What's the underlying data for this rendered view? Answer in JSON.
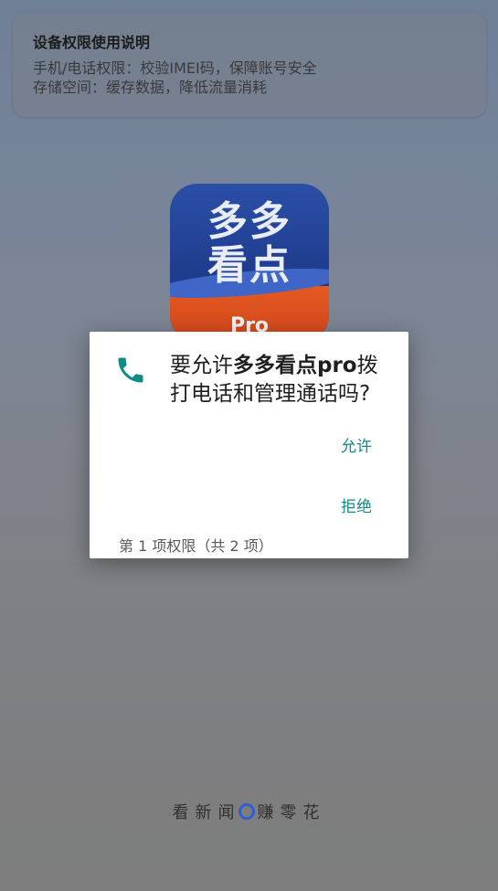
{
  "banner": {
    "title": "设备权限使用说明",
    "line1": "手机/电话权限：校验IMEI码，保障账号安全",
    "line2": "存储空间：缓存数据，降低流量消耗"
  },
  "logo": {
    "text_line1": "多多",
    "text_line2": "看点",
    "badge": "Pro"
  },
  "dialog": {
    "icon": "phone-icon",
    "msg_prefix": "要允许",
    "app_name": "多多看点pro",
    "msg_suffix": "拨打电话和管理通话吗?",
    "allow_label": "允许",
    "deny_label": "拒绝",
    "counter": "第 1 项权限（共 2 项）"
  },
  "slogan": {
    "left": "看新闻",
    "right": "赚零花"
  },
  "colors": {
    "accent": "#128a86",
    "logo_blue": "#1f3d8f",
    "logo_orange": "#d2451a"
  }
}
